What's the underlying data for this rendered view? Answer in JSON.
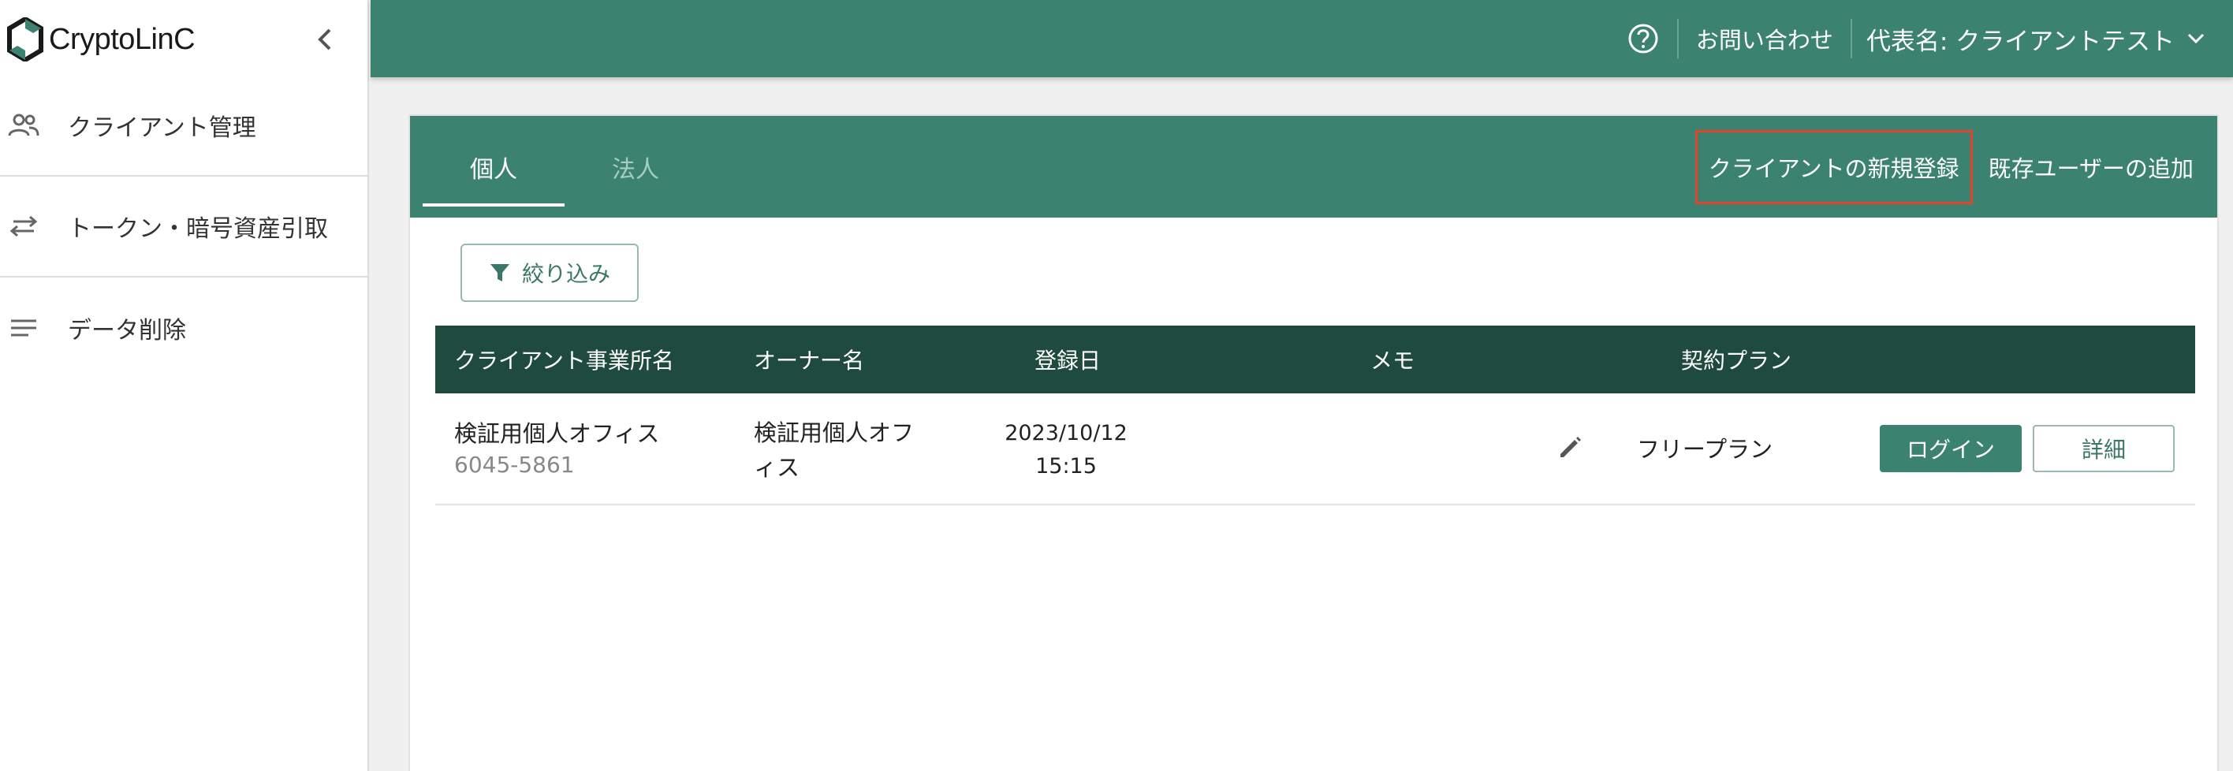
{
  "app": {
    "logo_text": "CryptoLinC"
  },
  "sidebar": {
    "items": [
      {
        "label": "クライアント管理",
        "icon": "people-icon"
      },
      {
        "label": "トークン・暗号資産引取",
        "icon": "swap-arrows-icon"
      },
      {
        "label": "データ削除",
        "icon": "lines-icon"
      }
    ]
  },
  "header": {
    "contact_label": "お問い合わせ",
    "representative_label": "代表名: クライアントテスト"
  },
  "tabs": {
    "individual": "個人",
    "corporate": "法人",
    "active": "individual"
  },
  "actions": {
    "new_client": "クライアントの新規登録",
    "add_existing_user": "既存ユーザーの追加"
  },
  "filter": {
    "label": "絞り込み"
  },
  "table": {
    "headers": {
      "office": "クライアント事業所名",
      "owner": "オーナー名",
      "registered": "登録日",
      "memo": "メモ",
      "plan": "契約プラン"
    },
    "rows": [
      {
        "office_name": "検証用個人オフィス",
        "office_id": "6045-5861",
        "owner_name": "検証用個人オフィス",
        "registered_date": "2023/10/12",
        "registered_time": "15:15",
        "plan": "フリープラン",
        "login_label": "ログイン",
        "detail_label": "詳細"
      }
    ]
  },
  "colors": {
    "primary": "#3b8370",
    "table_header": "#1f4a3e",
    "highlight": "#e0442c"
  }
}
